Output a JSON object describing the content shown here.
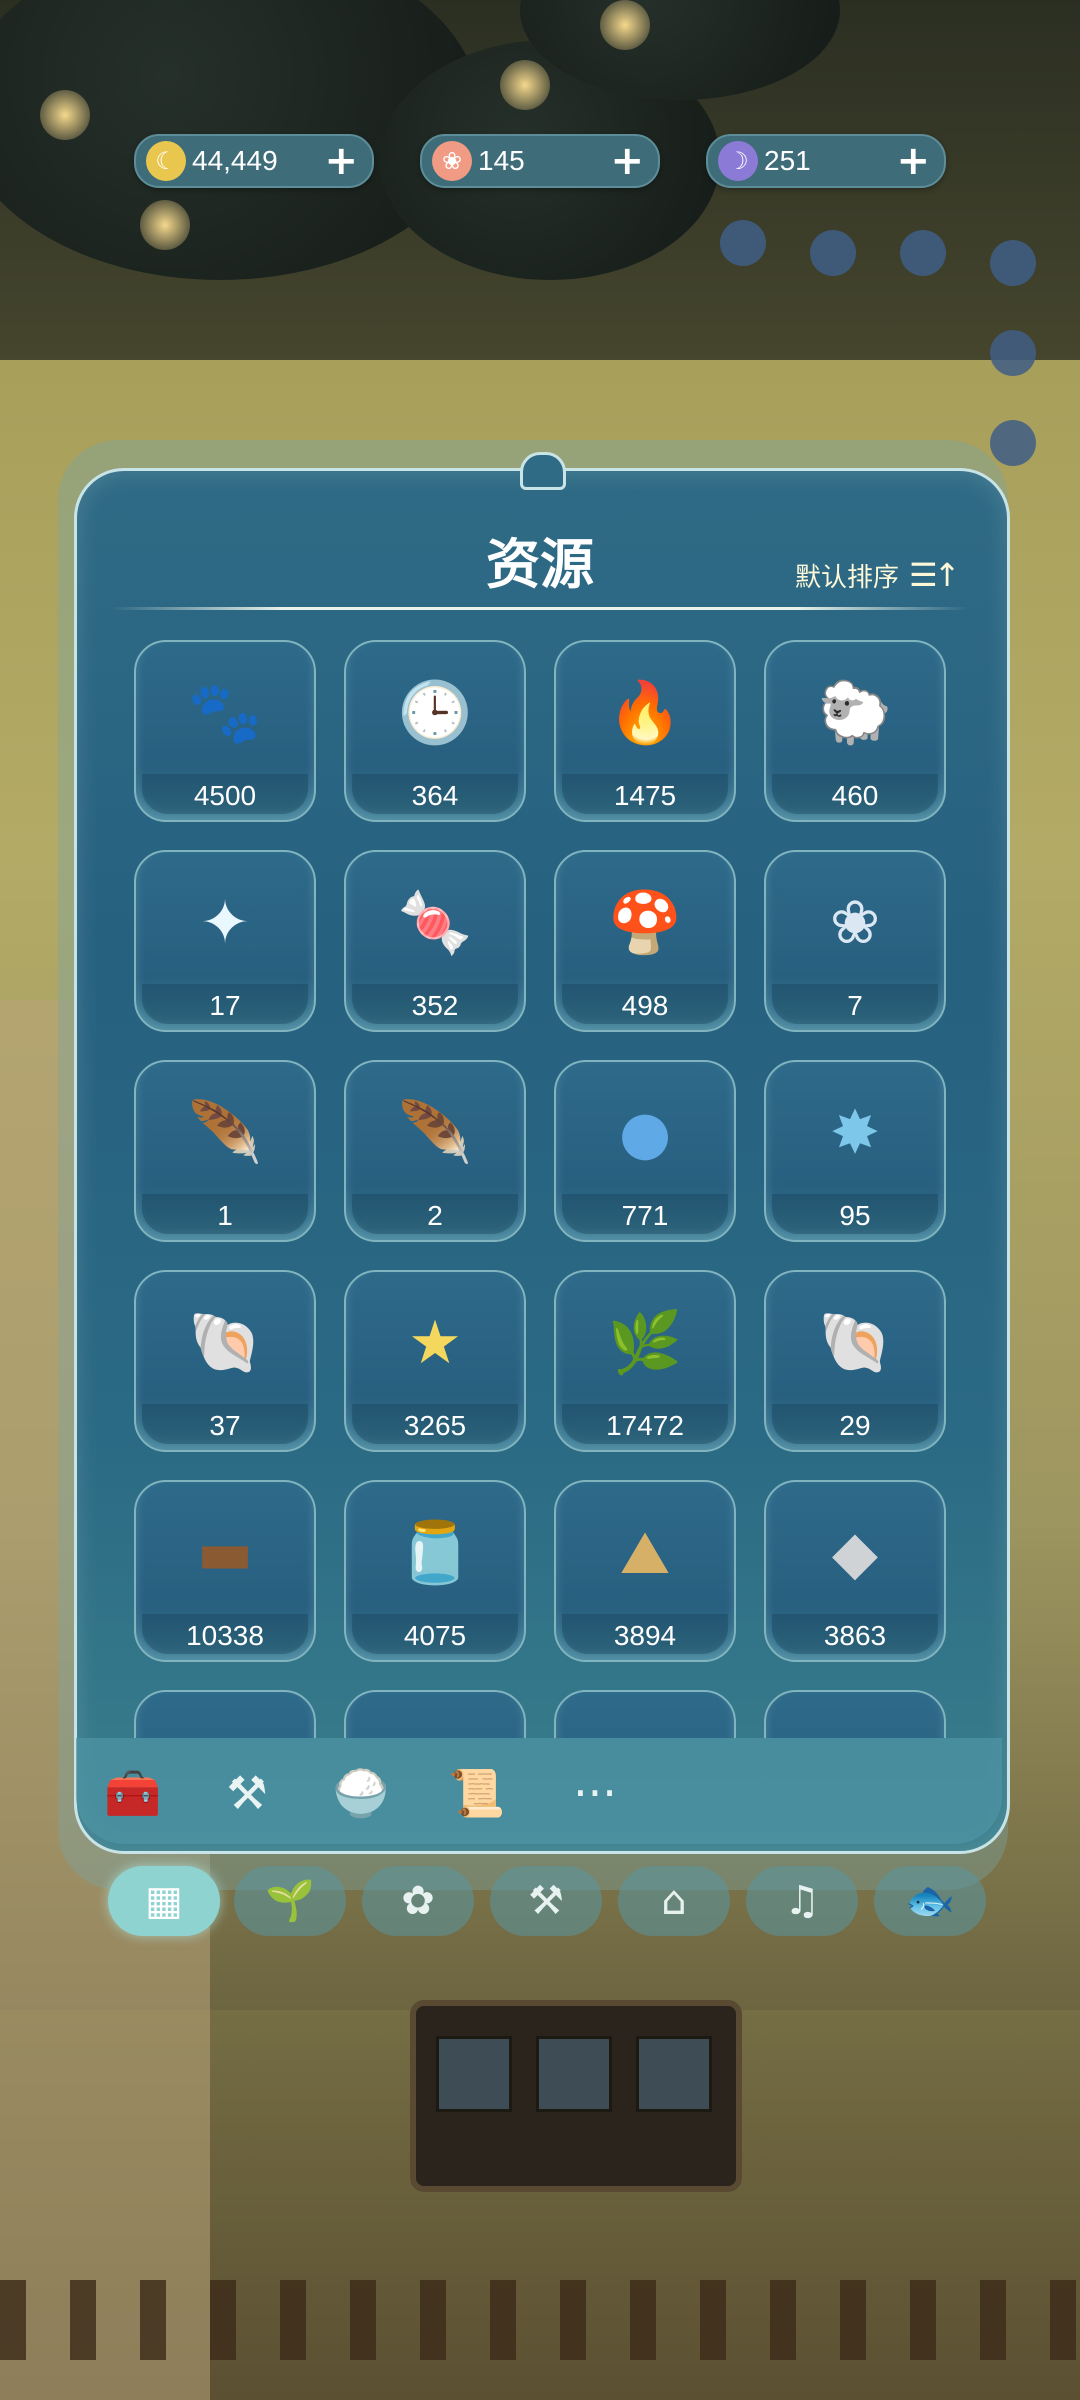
{
  "currencies": [
    {
      "icon": "moon-coin-icon",
      "value": "44,449",
      "color": "#e9c64e"
    },
    {
      "icon": "pink-flower-icon",
      "value": "145",
      "color": "#f19a84"
    },
    {
      "icon": "crescent-moon-icon",
      "value": "251",
      "color": "#8b7ad6"
    }
  ],
  "panel": {
    "title": "资源",
    "sort_label": "默认排序"
  },
  "resources": [
    {
      "icon": "paw-icon",
      "glyph": "🐾",
      "count": "4500",
      "color": "#bfeff0"
    },
    {
      "icon": "pocket-watch-icon",
      "glyph": "🕒",
      "count": "364",
      "color": "#f0cf5c"
    },
    {
      "icon": "purple-flame-icon",
      "glyph": "🔥",
      "count": "1475",
      "color": "#9c69d8"
    },
    {
      "icon": "sheep-icon",
      "glyph": "🐑",
      "count": "460",
      "color": "#f3e6d3"
    },
    {
      "icon": "glowing-orb-icon",
      "glyph": "✦",
      "count": "17",
      "color": "#e9f8ff"
    },
    {
      "icon": "candy-icon",
      "glyph": "🍬",
      "count": "352",
      "color": "#b6e04f"
    },
    {
      "icon": "glowing-mushroom-icon",
      "glyph": "🍄",
      "count": "498",
      "color": "#f7ec8d"
    },
    {
      "icon": "crystal-flower-icon",
      "glyph": "❀",
      "count": "7",
      "color": "#dbe7f2"
    },
    {
      "icon": "green-feather-icon",
      "glyph": "🪶",
      "count": "1",
      "color": "#6fe0c0"
    },
    {
      "icon": "blue-feather-icon",
      "glyph": "🪶",
      "count": "2",
      "color": "#5d8fe0"
    },
    {
      "icon": "blue-slime-icon",
      "glyph": "●",
      "count": "771",
      "color": "#5ea9e6"
    },
    {
      "icon": "spiky-star-icon",
      "glyph": "✸",
      "count": "95",
      "color": "#7cc7ea"
    },
    {
      "icon": "blue-shell-bug-icon",
      "glyph": "🐚",
      "count": "37",
      "color": "#5b9fe6"
    },
    {
      "icon": "yellow-star-icon",
      "glyph": "★",
      "count": "3265",
      "color": "#f4d85d"
    },
    {
      "icon": "grass-bundle-icon",
      "glyph": "🌿",
      "count": "17472",
      "color": "#7cbf6b"
    },
    {
      "icon": "pearl-clam-icon",
      "glyph": "🐚",
      "count": "29",
      "color": "#efe3c2"
    },
    {
      "icon": "wood-log-icon",
      "glyph": "▬",
      "count": "10338",
      "color": "#8a5a32"
    },
    {
      "icon": "firefly-jar-icon",
      "glyph": "🫙",
      "count": "4075",
      "color": "#f0a448"
    },
    {
      "icon": "sand-pile-icon",
      "glyph": "⛰",
      "count": "3894",
      "color": "#d7b068"
    },
    {
      "icon": "stone-icon",
      "glyph": "◆",
      "count": "3863",
      "color": "#d0d3d6"
    }
  ],
  "toolbar": [
    {
      "icon": "toolbox-icon",
      "glyph": "🧰"
    },
    {
      "icon": "spark-tool-icon",
      "glyph": "⚒"
    },
    {
      "icon": "food-bowl-icon",
      "glyph": "🍚"
    },
    {
      "icon": "scroll-icon",
      "glyph": "📜"
    },
    {
      "icon": "more-icon",
      "glyph": "···"
    }
  ],
  "tabs": [
    {
      "icon": "grid-icon",
      "glyph": "▦",
      "active": true
    },
    {
      "icon": "sprout-icon",
      "glyph": "🌱",
      "active": false
    },
    {
      "icon": "flower-icon",
      "glyph": "✿",
      "active": false
    },
    {
      "icon": "workbench-icon",
      "glyph": "⚒",
      "active": false
    },
    {
      "icon": "hanger-icon",
      "glyph": "⌂",
      "active": false
    },
    {
      "icon": "music-icon",
      "glyph": "♫",
      "active": false
    },
    {
      "icon": "fish-plant-icon",
      "glyph": "🐟",
      "active": false
    }
  ]
}
